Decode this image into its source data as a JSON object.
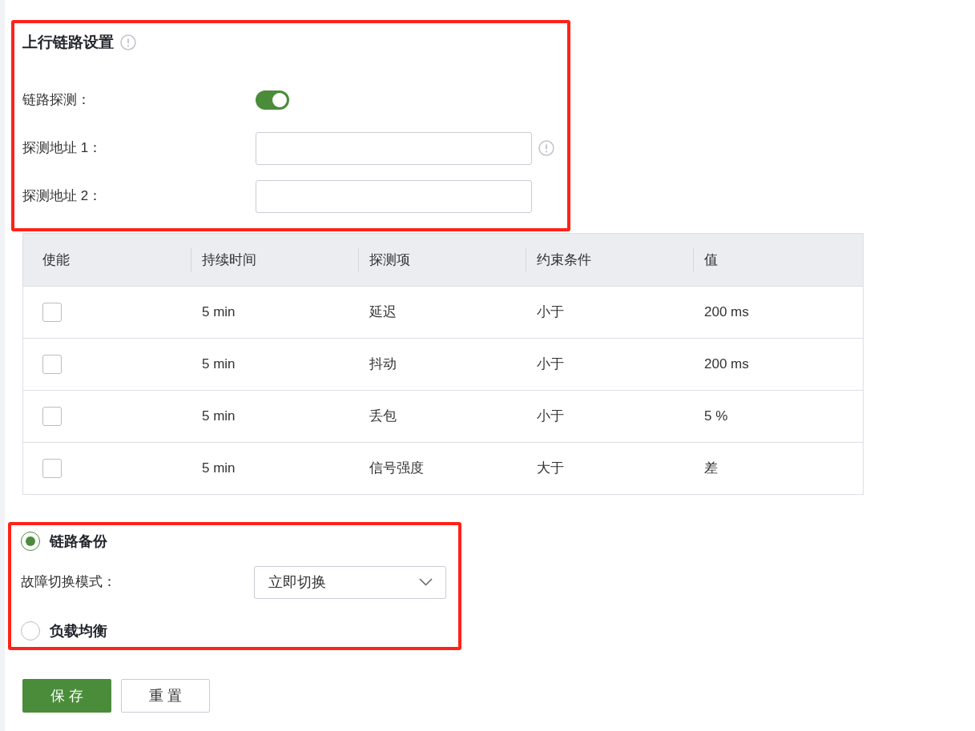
{
  "uplink": {
    "title": "上行链路设置",
    "probe": {
      "label": "链路探测：",
      "on": true
    },
    "fields": [
      {
        "label": "探测地址 1：",
        "info": true
      },
      {
        "label": "探测地址 2：",
        "info": false
      }
    ]
  },
  "table": {
    "columns": [
      "使能",
      "持续时间",
      "探测项",
      "约束条件",
      "值"
    ],
    "rows": [
      {
        "checked": false,
        "cells": [
          "",
          "5 min",
          "延迟",
          "小于",
          "200 ms"
        ]
      },
      {
        "checked": false,
        "cells": [
          "",
          "5 min",
          "抖动",
          "小于",
          "200 ms"
        ]
      },
      {
        "checked": false,
        "cells": [
          "",
          "5 min",
          "丢包",
          "小于",
          "5 %"
        ]
      },
      {
        "checked": false,
        "cells": [
          "",
          "5 min",
          "信号强度",
          "大于",
          "差"
        ]
      }
    ]
  },
  "modes": [
    {
      "label": "链路备份",
      "selected": true,
      "switch": {
        "label": "故障切换模式：",
        "value": "立即切换"
      }
    },
    {
      "label": "负载均衡",
      "selected": false
    }
  ],
  "buttons": [
    {
      "label": "保 存",
      "kind": "primary"
    },
    {
      "label": "重 置",
      "kind": "default"
    }
  ]
}
